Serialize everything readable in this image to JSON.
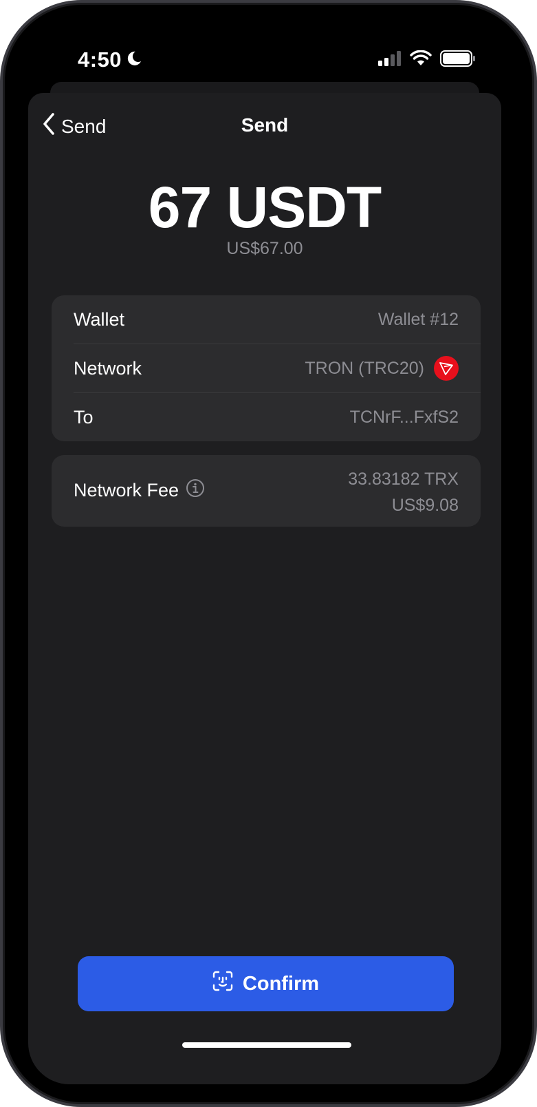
{
  "status_bar": {
    "time": "4:50"
  },
  "nav": {
    "back_label": "Send",
    "title": "Send"
  },
  "amount": {
    "crypto": "67 USDT",
    "fiat": "US$67.00"
  },
  "details": {
    "wallet_label": "Wallet",
    "wallet_value": "Wallet #12",
    "network_label": "Network",
    "network_value": "TRON (TRC20)",
    "to_label": "To",
    "to_value": "TCNrF...FxfS2"
  },
  "fee": {
    "label": "Network Fee",
    "crypto": "33.83182 TRX",
    "fiat": "US$9.08"
  },
  "confirm": {
    "label": "Confirm"
  },
  "colors": {
    "accent": "#2c5ce6",
    "tron": "#e8101c",
    "card_bg": "#2c2c2e",
    "secondary_text": "#8d8d93"
  }
}
